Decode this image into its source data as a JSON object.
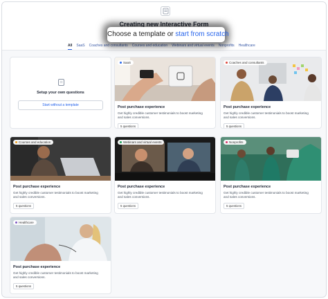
{
  "header": {
    "title": "Creating new Interactive Form",
    "subtitle_lead": "Choose a template or",
    "subtitle_link": "start from scratch"
  },
  "tabs": [
    {
      "label": "All",
      "active": true
    },
    {
      "label": "SaaS"
    },
    {
      "label": "Coaches and consultants"
    },
    {
      "label": "Courses and education"
    },
    {
      "label": "Webinars and virtual events"
    },
    {
      "label": "Nonprofits"
    },
    {
      "label": "Healthcare"
    }
  ],
  "setup": {
    "label": "Setup your own questions",
    "button": "Start without a template"
  },
  "cards": [
    {
      "badge": "SaaS",
      "badge_color": "#2c6bed",
      "title": "Post purchase experience",
      "desc": "Get highly credible customer testimonials to boost marketing and sales conversions.",
      "questions": "5 questions"
    },
    {
      "badge": "Coaches and consultants",
      "badge_color": "#e0473b",
      "title": "Post purchase experience",
      "desc": "Get highly credible customer testimonials to boost marketing and sales conversions.",
      "questions": "5 questions"
    },
    {
      "badge": "Courses and education",
      "badge_color": "#f0a020",
      "title": "Post purchase experience",
      "desc": "Get highly credible customer testimonials to boost marketing and sales conversions.",
      "questions": "5 questions"
    },
    {
      "badge": "Webinars and virtual events",
      "badge_color": "#22a35a",
      "title": "Post purchase experience",
      "desc": "Get highly credible customer testimonials to boost marketing and sales conversions.",
      "questions": "5 questions"
    },
    {
      "badge": "Nonprofits",
      "badge_color": "#d9366d",
      "title": "Post purchase experience",
      "desc": "Get highly credible customer testimonials to boost marketing and sales conversions.",
      "questions": "5 questions"
    },
    {
      "badge": "Healthcare",
      "badge_color": "#7e57c2",
      "title": "Post purchase experience",
      "desc": "Get highly credible customer testimonials to boost marketing and sales conversions.",
      "questions": "5 questions"
    }
  ]
}
